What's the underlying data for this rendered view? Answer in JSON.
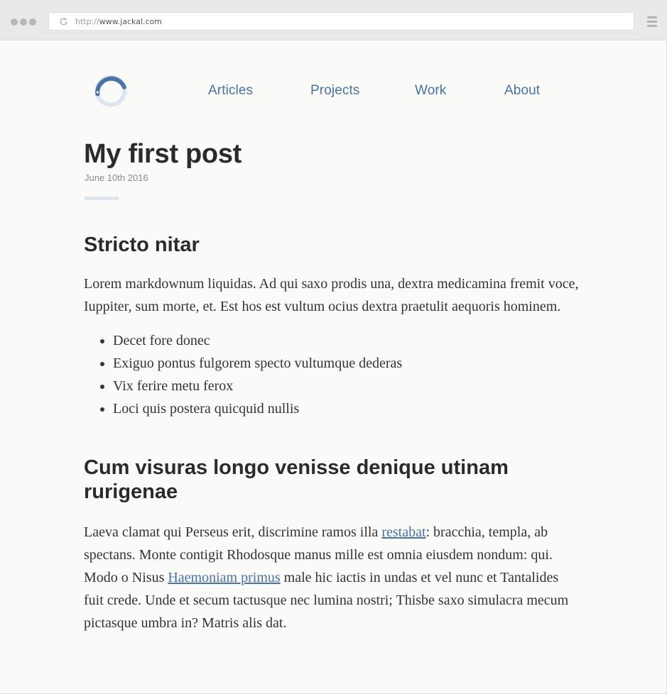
{
  "browser": {
    "url_prefix": "http://",
    "url_host": "www.jackal.com"
  },
  "nav": {
    "items": [
      {
        "label": "Articles"
      },
      {
        "label": "Projects"
      },
      {
        "label": "Work"
      },
      {
        "label": "About"
      }
    ]
  },
  "post": {
    "title": "My first post",
    "date": "June 10th 2016",
    "section1": {
      "heading": "Stricto nitar",
      "paragraph": "Lorem markdownum liquidas. Ad qui saxo prodis una, dextra medicamina fremit voce, Iuppiter, sum morte, et. Est hos est vultum ocius dextra praetulit aequoris hominem.",
      "list": [
        "Decet fore donec",
        "Exiguo pontus fulgorem specto vultumque dederas",
        "Vix ferire metu ferox",
        "Loci quis postera quicquid nullis"
      ]
    },
    "section2": {
      "heading": "Cum visuras longo venisse denique utinam rurigenae",
      "p_part1": "Laeva clamat qui Perseus erit, discrimine ramos illa ",
      "link1": "restabat",
      "p_part2": ": bracchia, templa, ab spectans. Monte contigit Rhodosque manus mille est omnia eiusdem nondum: qui. Modo o Nisus ",
      "link2": "Haemoniam primus",
      "p_part3": " male hic iactis in undas et vel nunc et Tantalides fuit crede. Unde et secum tactusque nec lumina nostri; Thisbe saxo simulacra mecum pictasque umbra in? Matris alis dat."
    }
  },
  "colors": {
    "accent": "#4a72a5",
    "logo_light": "#dde5ef",
    "background": "#fafaf9"
  }
}
